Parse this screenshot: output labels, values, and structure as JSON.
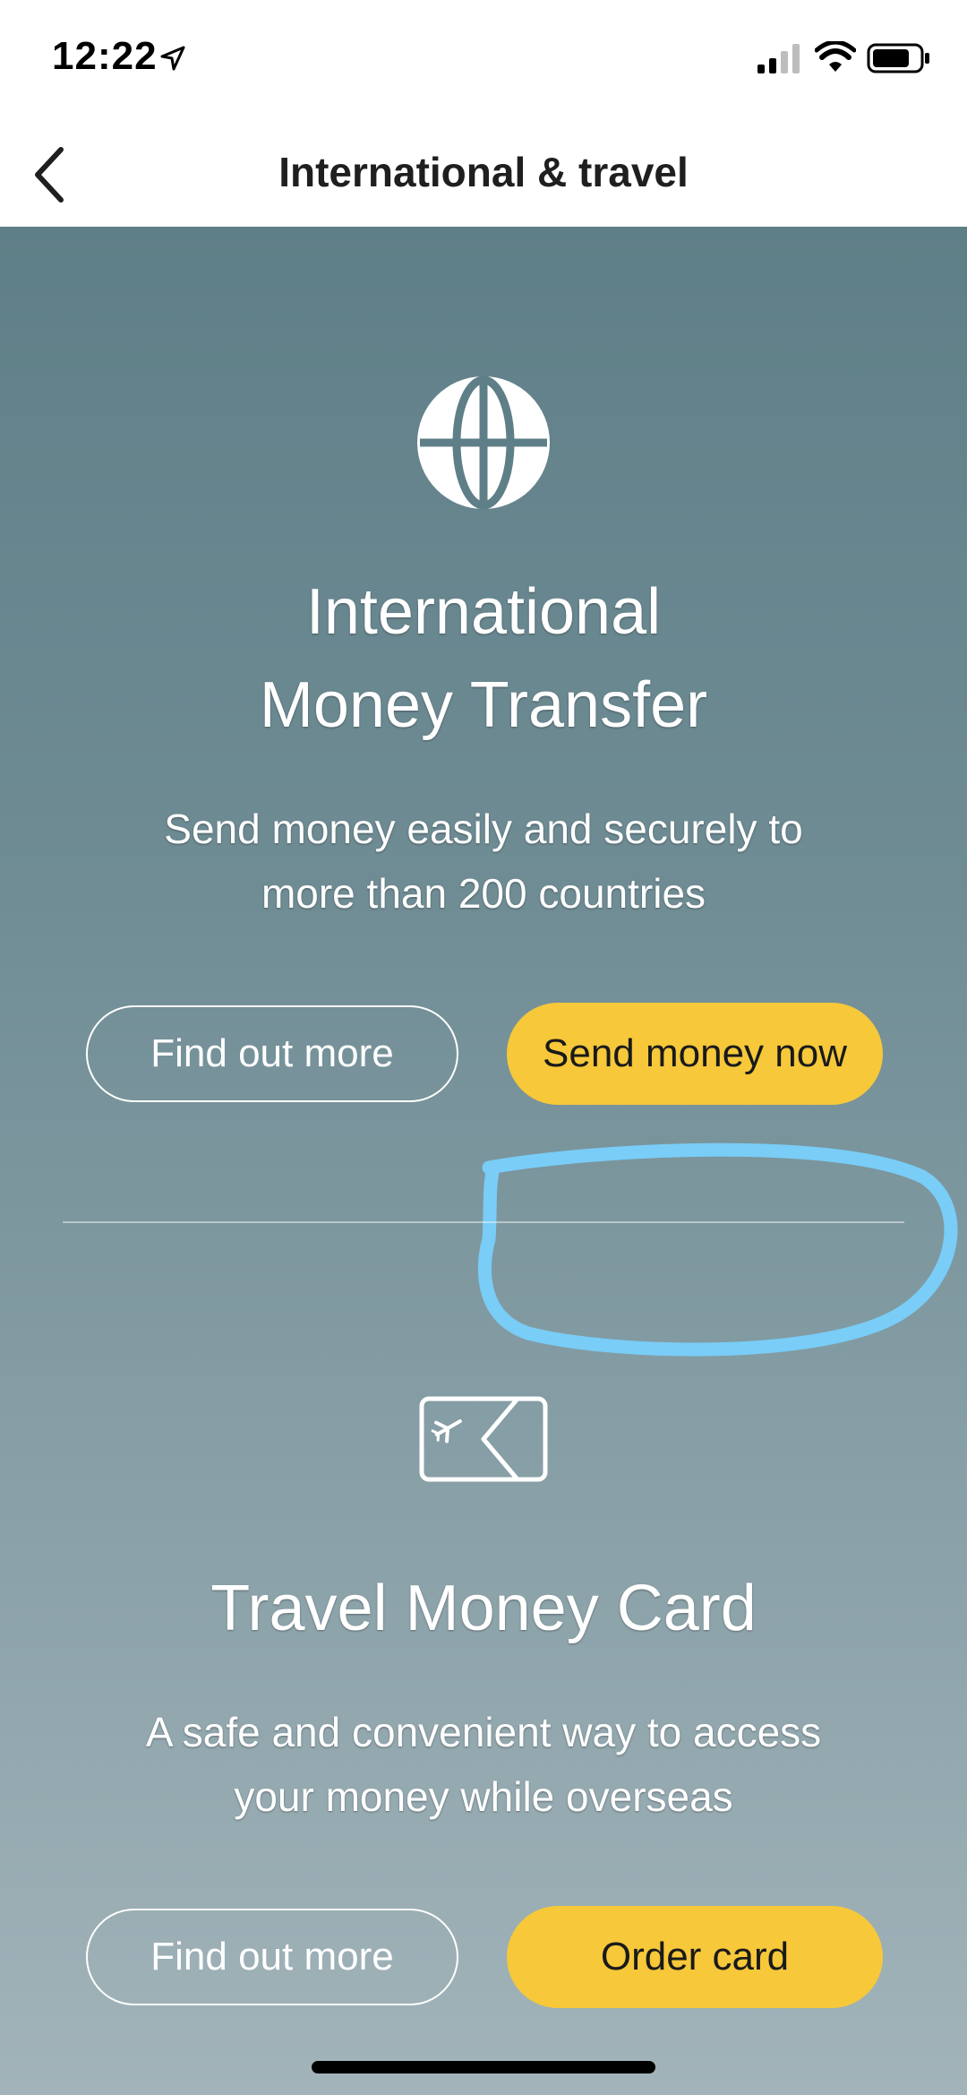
{
  "status_bar": {
    "time": "12:22",
    "icons": [
      "location-arrow-icon",
      "cellular-signal-icon",
      "wifi-icon",
      "battery-icon"
    ]
  },
  "nav": {
    "title": "International & travel",
    "back_icon": "chevron-left-icon"
  },
  "money_transfer": {
    "icon": "globe-icon",
    "title_line1": "International",
    "title_line2": "Money Transfer",
    "desc_line1": "Send money easily and securely to",
    "desc_line2": "more than 200 countries",
    "secondary_label": "Find out more",
    "primary_label": "Send money now"
  },
  "travel_card": {
    "icon": "plane-card-icon",
    "title": "Travel Money Card",
    "desc_line1": "A safe and convenient way to access",
    "desc_line2": "your money while overseas",
    "secondary_label": "Find out more",
    "primary_label": "Order card"
  },
  "colors": {
    "accent_yellow": "#f6c83a",
    "annotation_blue": "#79cdf7",
    "background_top": "#5f7f88",
    "background_bottom": "#a2b4ba"
  }
}
